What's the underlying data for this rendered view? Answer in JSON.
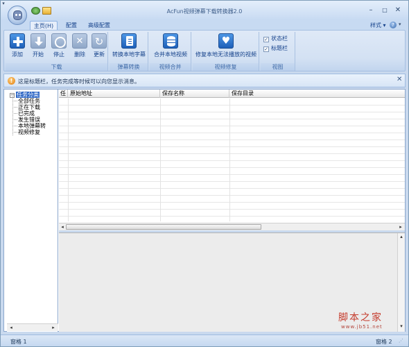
{
  "window": {
    "title": "AcFun视频弹幕下载转换器2.0",
    "controls": {
      "minimize": "–",
      "maximize": "□",
      "close": "✕"
    }
  },
  "quick_access": {
    "dropdown": "▾"
  },
  "ribbon_tabs": [
    {
      "label": "主页(H)",
      "active": true
    },
    {
      "label": "配置",
      "active": false
    },
    {
      "label": "高级配置",
      "active": false
    }
  ],
  "style_menu": {
    "label": "样式",
    "dropdown": "▾"
  },
  "help": {
    "icon": "?"
  },
  "groups": {
    "download": {
      "label": "下载",
      "buttons": [
        {
          "label": "添加",
          "icon": "add-icon",
          "enabled": true
        },
        {
          "label": "开始",
          "icon": "download-icon",
          "enabled": false
        },
        {
          "label": "停止",
          "icon": "stop-icon",
          "enabled": false
        },
        {
          "label": "删除",
          "icon": "delete-icon",
          "enabled": false
        },
        {
          "label": "更新",
          "icon": "refresh-icon",
          "enabled": false
        }
      ]
    },
    "danmaku": {
      "label": "弹幕转换",
      "button": "转换本地字幕"
    },
    "merge": {
      "label": "视频合并",
      "button": "合并本地视频"
    },
    "repair": {
      "label": "视频修复",
      "button": "修复本地无法播放的视频"
    },
    "view": {
      "label": "视图",
      "checkboxes": [
        {
          "label": "状态栏",
          "checked": true
        },
        {
          "label": "标题栏",
          "checked": true
        }
      ],
      "check_mark": "✓"
    }
  },
  "infobar": {
    "icon": "!",
    "text": "这是标题栏，任务完成等时候可以向您显示消息。",
    "close": "✕"
  },
  "tree": {
    "toggle": "−",
    "root": "任务分类",
    "items": [
      "全部任务",
      "正在下载",
      "已完成",
      "发生错误",
      "本地弹幕转",
      "视频修复"
    ]
  },
  "table": {
    "columns": [
      "任",
      "原始地址",
      "保存名称",
      "保存目录"
    ],
    "rows": []
  },
  "scroll": {
    "left": "◂",
    "right": "▸",
    "up": "▴",
    "down": "▾"
  },
  "statusbar": {
    "left": "窗格 1",
    "right": "窗格 2",
    "grip": "⋰"
  },
  "watermark": {
    "main": "脚本之家",
    "sub": "www.jb51.net"
  },
  "colors": {
    "accent": "#3169c6",
    "ribbon": "#d3e1f3",
    "title_text": "#3e5e8a"
  }
}
